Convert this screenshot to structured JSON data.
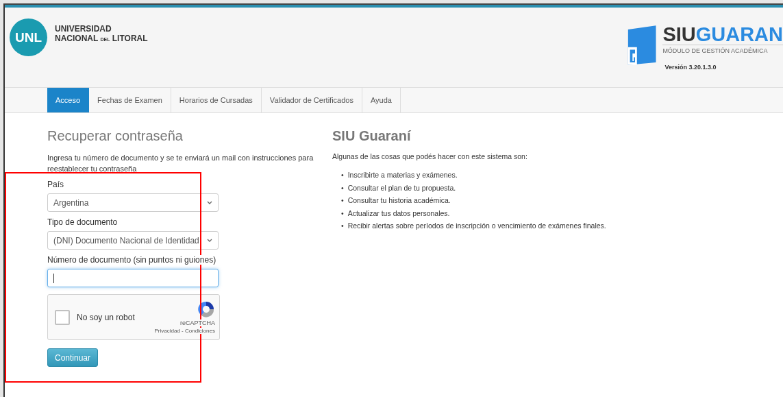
{
  "header": {
    "logo_text": "UNL",
    "university_line1": "UNIVERSIDAD",
    "university_line2": [
      "NACIONAL",
      "DEL",
      "LITORAL"
    ],
    "product_name": [
      "SIU",
      "GUARAN"
    ],
    "product_subtitle": "MÓDULO DE GESTIÓN ACADÉMICA",
    "version": "Versión 3.20.1.3.0"
  },
  "tabs": [
    {
      "label": "Acceso",
      "selected": true
    },
    {
      "label": "Fechas de Examen",
      "selected": false
    },
    {
      "label": "Horarios de Cursadas",
      "selected": false
    },
    {
      "label": "Validador de Certificados",
      "selected": false
    },
    {
      "label": "Ayuda",
      "selected": false
    }
  ],
  "form": {
    "title": "Recuperar contraseña",
    "instructions": "Ingresa tu número de documento y se te enviará un mail con instrucciones para reestablecer tu contraseña",
    "fields": [
      {
        "kind": "select",
        "label": "País",
        "value": "Argentina",
        "focused": false
      },
      {
        "kind": "select",
        "label": "Tipo de documento",
        "value": "(DNI) Documento Nacional de Identidad",
        "focused": false
      },
      {
        "kind": "text",
        "label": "Número de documento (sin puntos ni guiones)",
        "focused": true
      }
    ],
    "captcha": {
      "label": "No soy un robot",
      "checked": false,
      "brand": "reCAPTCHA",
      "links": "Privacidad - Condiciones"
    },
    "button": "Continuar"
  },
  "info": {
    "title": "SIU Guaraní",
    "intro": "Algunas de las cosas que podés hacer con este sistema son:",
    "items": [
      {
        "bullet": "•",
        "text": "Inscribirte a materias y exámenes."
      },
      {
        "bullet": "•",
        "text": "Consultar el plan de tu propuesta."
      },
      {
        "bullet": "•",
        "text": "Consultar tu historia académica."
      },
      {
        "bullet": "•",
        "text": "Actualizar tus datos personales."
      },
      {
        "bullet": "•",
        "text": "Recibir alertas sobre períodos de inscripción o vencimiento de exámenes finales."
      }
    ]
  },
  "annotation": {
    "kind": "rectangle"
  }
}
